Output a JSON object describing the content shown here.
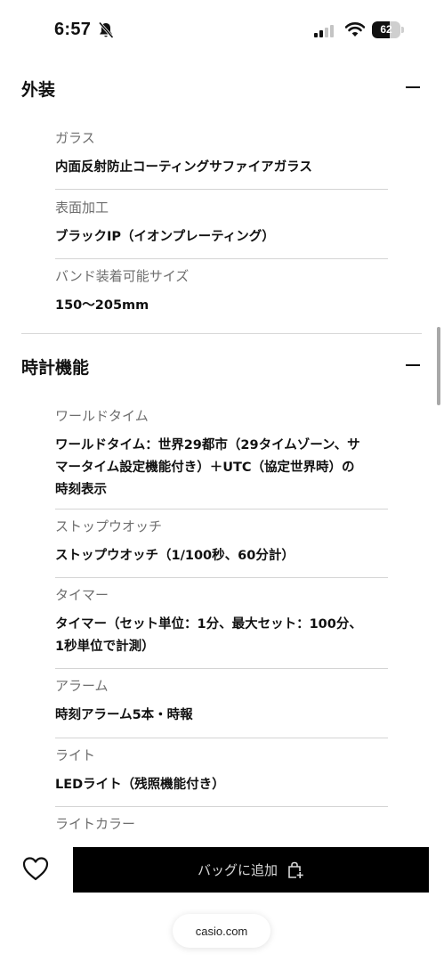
{
  "status_bar": {
    "time": "6:57",
    "battery": 62
  },
  "sections": [
    {
      "title": "外装",
      "items": [
        {
          "label": "ガラス",
          "value": "内面反射防止コーティングサファイアガラス"
        },
        {
          "label": "表面加工",
          "value": "ブラックIP（イオンプレーティング）"
        },
        {
          "label": "バンド装着可能サイズ",
          "value": "150〜205mm"
        }
      ]
    },
    {
      "title": "時計機能",
      "items": [
        {
          "label": "ワールドタイム",
          "value_lines": [
            "ワールドタイム：世界29都市（29タイムゾーン、サ",
            "マータイム設定機能付き）＋UTC（協定世界時）の",
            "時刻表示"
          ]
        },
        {
          "label": "ストップウオッチ",
          "value": "ストップウオッチ（1/100秒、60分計）"
        },
        {
          "label": "タイマー",
          "value_lines": [
            "タイマー（セット単位：1分、最大セット：100分、",
            "1秒単位で計測）"
          ]
        },
        {
          "label": "アラーム",
          "value": "時刻アラーム5本・時報"
        },
        {
          "label": "ライト",
          "value": "LEDライト（残照機能付き）"
        },
        {
          "label": "ライトカラー"
        }
      ]
    }
  ],
  "bottom_bar": {
    "add_to_bag_label": "バッグに追加",
    "url": "casio.com"
  },
  "icons": {
    "bell": "bell-slash-icon",
    "signal": "cellular-signal-icon",
    "wifi": "wifi-icon",
    "collapse": "minus-icon",
    "favorite": "heart-outline-icon",
    "bag": "bag-add-icon"
  },
  "colors": {
    "button_bg": "#000000",
    "button_text": "#d9d9d9",
    "label_text": "#6e6e6e",
    "value_text": "#111111",
    "divider": "#d4d4d4"
  }
}
